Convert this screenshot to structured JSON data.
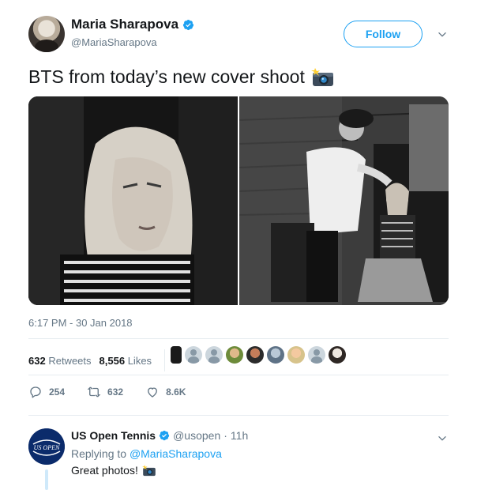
{
  "author": {
    "name": "Maria Sharapova",
    "handle": "@MariaSharapova",
    "verified": true
  },
  "follow_label": "Follow",
  "tweet": {
    "text": "BTS from today’s new cover shoot",
    "emoji": "camera-with-flash-icon",
    "timestamp": "6:17 PM - 30 Jan 2018"
  },
  "stats": {
    "retweets_count": "632",
    "retweets_label": "Retweets",
    "likes_count": "8,556",
    "likes_label": "Likes"
  },
  "actions": {
    "reply_count": "254",
    "retweet_count": "632",
    "like_count": "8.6K"
  },
  "reply": {
    "name": "US Open Tennis",
    "handle": "@usopen",
    "separator": "·",
    "time": "11h",
    "replying_prefix": "Replying to",
    "replying_to": "@MariaSharapova",
    "text": "Great photos!",
    "avatar_text": "US OPEN"
  },
  "colors": {
    "accent": "#1da1f2",
    "muted": "#657786",
    "text": "#14171a",
    "divider": "#e6ecf0"
  }
}
